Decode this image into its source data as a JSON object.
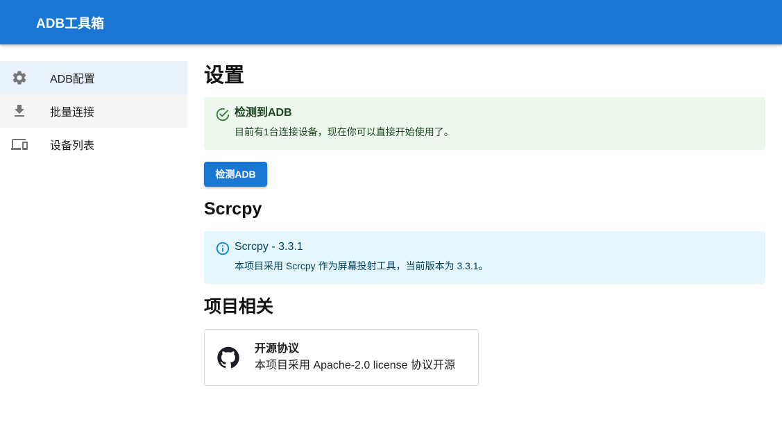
{
  "app": {
    "title": "ADB工具箱"
  },
  "sidebar": {
    "items": [
      {
        "label": "ADB配置",
        "icon": "gear-icon"
      },
      {
        "label": "批量连接",
        "icon": "download-icon"
      },
      {
        "label": "设备列表",
        "icon": "devices-icon"
      }
    ]
  },
  "main": {
    "title": "设置",
    "adb_alert": {
      "icon": "check-circle-icon",
      "title": "检测到ADB",
      "message": "目前有1台连接设备，现在你可以直接开始使用了。"
    },
    "detect_button_label": "检测ADB",
    "scrcpy_section_title": "Scrcpy",
    "scrcpy_alert": {
      "icon": "info-icon",
      "title": "Scrcpy - 3.3.1",
      "message": "本项目采用 Scrcpy 作为屏幕投射工具，当前版本为 3.3.1。"
    },
    "project_section_title": "项目相关",
    "license_card": {
      "icon": "github-icon",
      "title": "开源协议",
      "description": "本项目采用 Apache-2.0 license 协议开源"
    }
  },
  "colors": {
    "primary": "#1976d2",
    "success_bg": "#edf7ed",
    "success_icon": "#2e7d32",
    "info_bg": "#e5f6fd",
    "info_icon": "#0288d1"
  }
}
